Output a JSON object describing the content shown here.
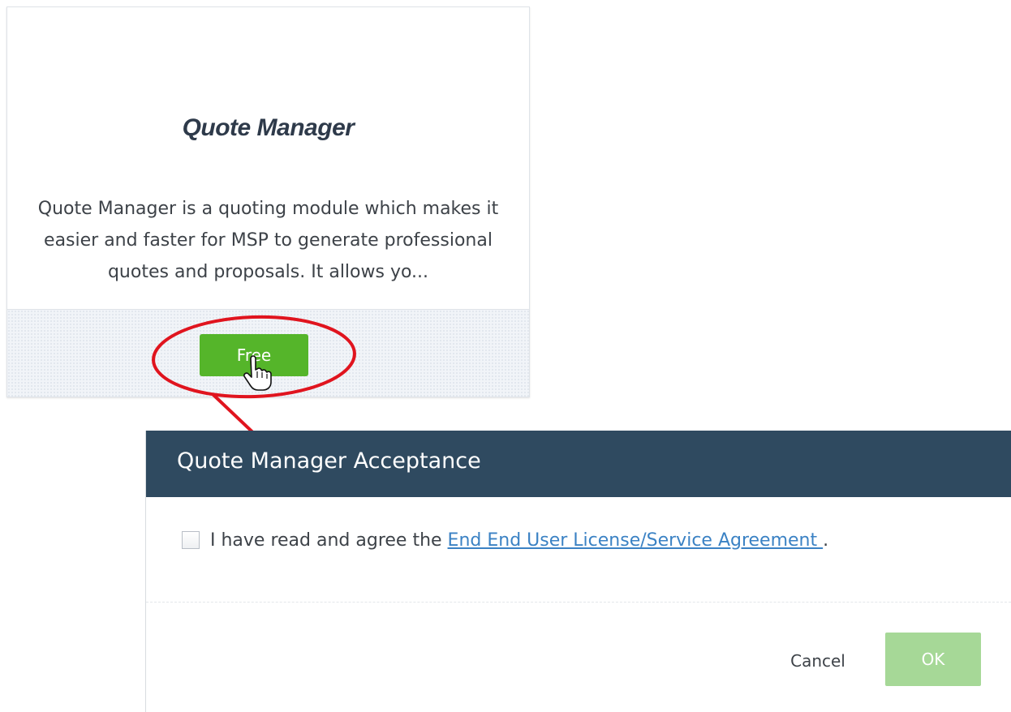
{
  "card": {
    "logo_text": "Quote Manager",
    "description": "Quote Manager is a quoting module which makes it easier and faster for MSP to generate professional quotes and proposals. It allows yo...",
    "free_button_label": "Free"
  },
  "dialog": {
    "title": "Quote Manager Acceptance",
    "agree_prefix": "I have read and agree the ",
    "agreement_link_text": "End End User License/Service Agreement ",
    "agree_suffix": ".",
    "agreed": false,
    "cancel_label": "Cancel",
    "ok_label": "OK",
    "ok_enabled": false
  },
  "colors": {
    "free_button": "#55b52a",
    "dialog_header": "#2f4a60",
    "link": "#3b82c4",
    "ok_disabled": "#a6d897",
    "annotation": "#e0141e"
  },
  "icons": {
    "cursor": "hand-pointer-icon",
    "annotation_highlight": "red-ellipse",
    "annotation_pointer": "red-arrow"
  }
}
